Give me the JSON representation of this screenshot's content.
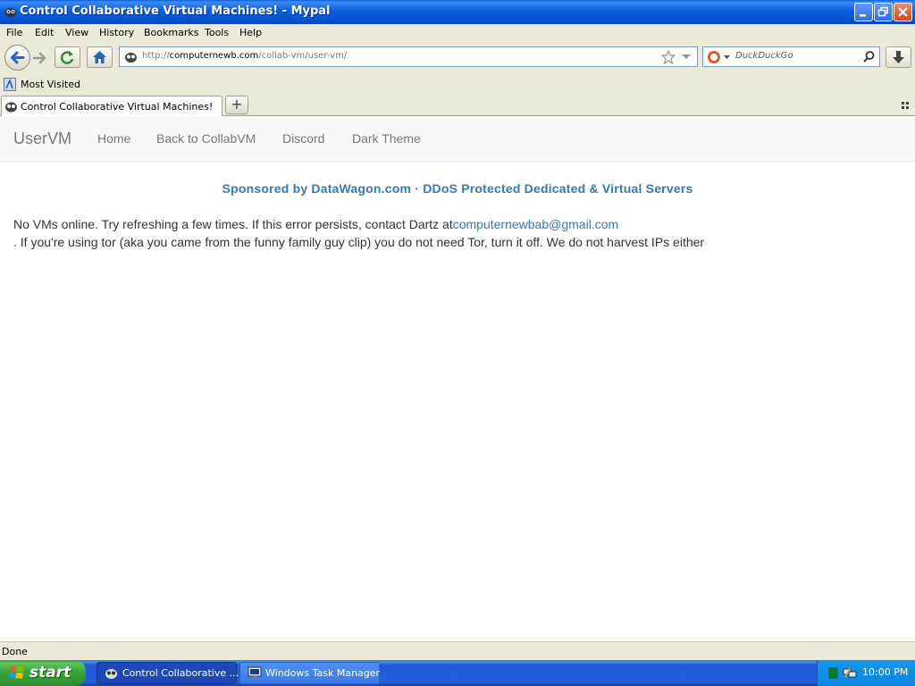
{
  "window": {
    "title": "Control Collaborative Virtual Machines! - Mypal"
  },
  "menu": [
    {
      "label": "File"
    },
    {
      "label": "Edit"
    },
    {
      "label": "View"
    },
    {
      "label": "History"
    },
    {
      "label": "Bookmarks"
    },
    {
      "label": "Tools"
    },
    {
      "label": "Help"
    }
  ],
  "address_bar": {
    "prefix": "http://",
    "domain": "computernewb.com",
    "path": "/collab-vm/user-vm/"
  },
  "search_bar": {
    "engine": "DuckDuckGo"
  },
  "bookmarks": {
    "most_visited": "Most Visited"
  },
  "tabs": [
    {
      "label": "Control Collaborative Virtual Machines!"
    }
  ],
  "site": {
    "brand": "UserVM",
    "nav": [
      {
        "label": "Home"
      },
      {
        "label": "Back to CollabVM"
      },
      {
        "label": "Discord"
      },
      {
        "label": "Dark Theme"
      }
    ],
    "sponsor": "Sponsored by DataWagon.com · DDoS Protected Dedicated & Virtual Servers",
    "message_line1": "No VMs online. Try refreshing a few times. If this error persists, contact Dartz at",
    "contact_email": "computernewbab@gmail.com",
    "message_line2": ". If you're using tor (aka you came from the funny family guy clip) you do not need Tor, turn it off. We do not harvest IPs either",
    "link_color": "#337ab7"
  },
  "status": {
    "text": "Done"
  },
  "taskbar": {
    "start_label": "start",
    "tasks": [
      {
        "label": "Control Collaborative ...",
        "active": true
      },
      {
        "label": "Windows Task Manager",
        "active": false
      }
    ],
    "clock": "10:00 PM"
  }
}
